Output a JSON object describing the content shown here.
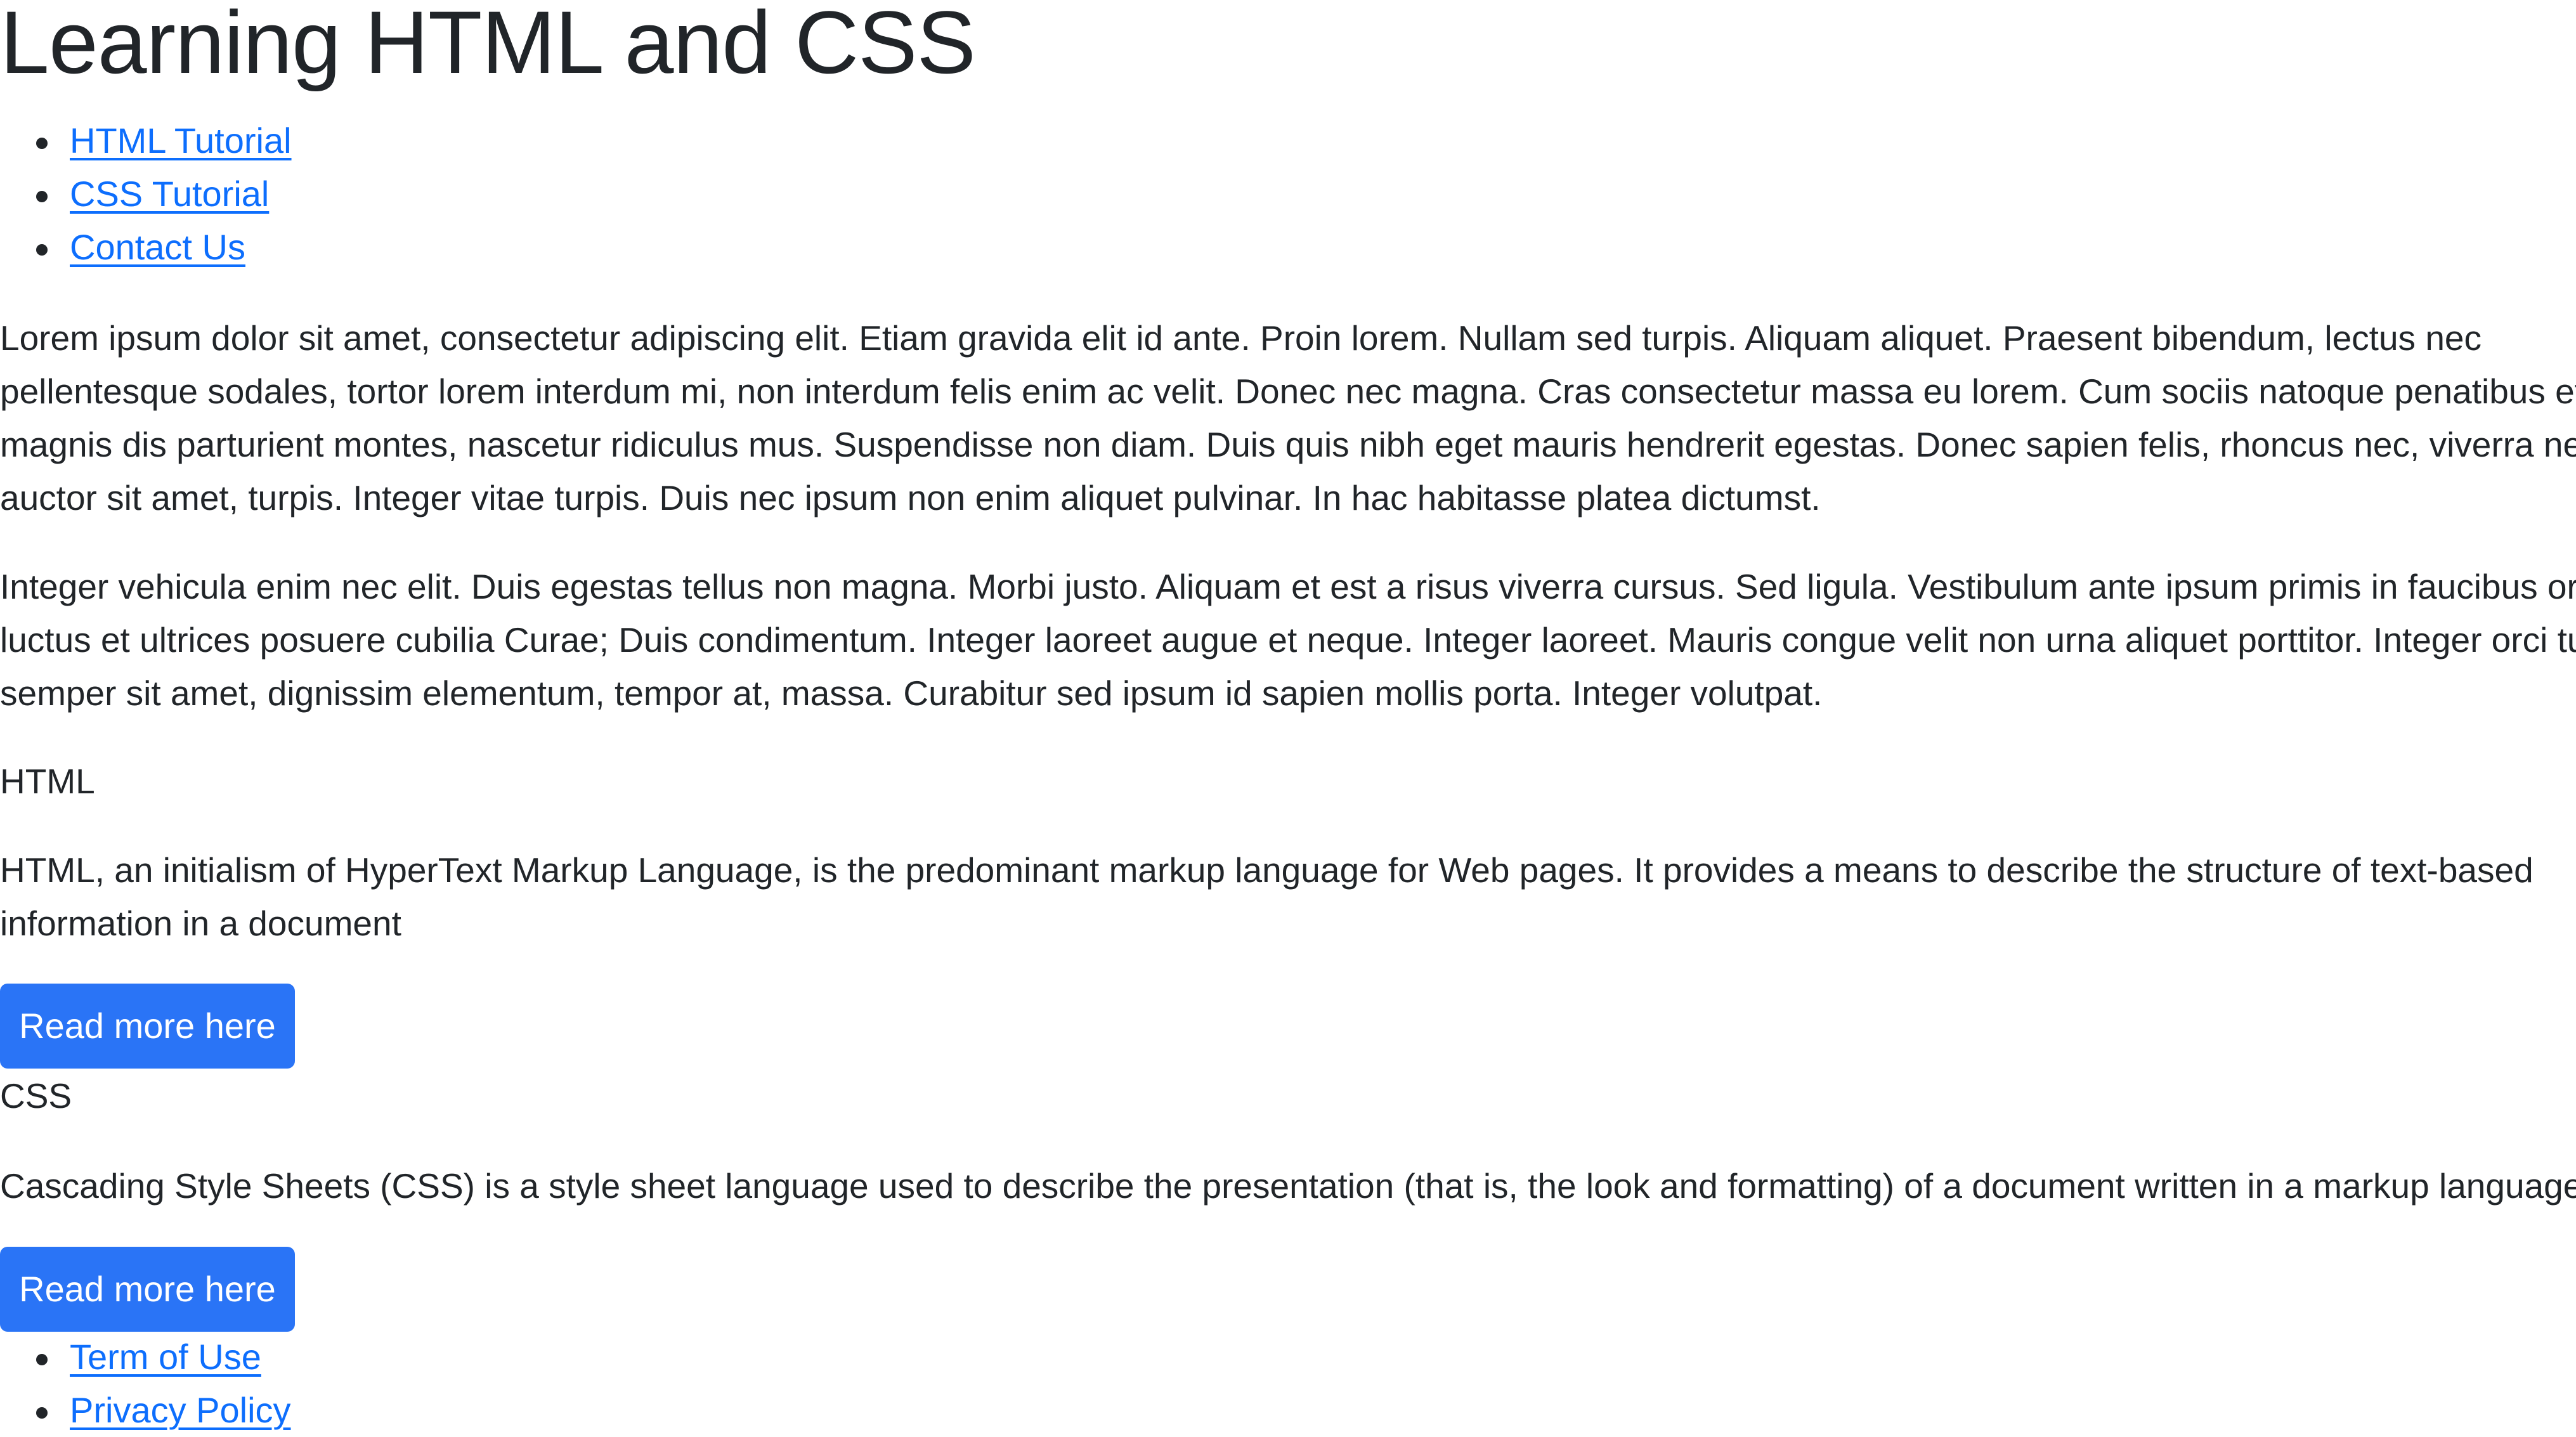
{
  "page": {
    "title": "Learning HTML and CSS"
  },
  "nav": {
    "items": [
      {
        "label": "HTML Tutorial"
      },
      {
        "label": "CSS Tutorial"
      },
      {
        "label": "Contact Us"
      }
    ]
  },
  "intro": {
    "paragraph_1_lines": [
      "Lorem ipsum dolor sit amet, consectetur adipiscing elit. Etiam gravida elit id ante. Proin lorem. Nullam sed turpis. Aliquam aliquet. Praesent bibendum, lectus nec",
      "pellentesque sodales, tortor lorem interdum mi, non interdum felis enim ac velit. Donec nec magna. Cras consectetur massa eu lorem. Cum sociis natoque penatibus et",
      "magnis dis parturient montes, nascetur ridiculus mus. Suspendisse non diam. Duis quis nibh eget mauris hendrerit egestas. Donec sapien felis, rhoncus nec, viverra nec,",
      "auctor sit amet, turpis. Integer vitae turpis. Duis nec ipsum non enim aliquet pulvinar. In hac habitasse platea dictumst."
    ],
    "paragraph_2_lines": [
      "Integer vehicula enim nec elit. Duis egestas tellus non magna. Morbi justo. Aliquam et est a risus viverra cursus. Sed ligula. Vestibulum ante ipsum primis in faucibus orci",
      "luctus et ultrices posuere cubilia Curae; Duis condimentum. Integer laoreet augue et neque. Integer laoreet. Mauris congue velit non urna aliquet porttitor. Integer orci turpis,",
      "semper sit amet, dignissim elementum, tempor at, massa. Curabitur sed ipsum id sapien mollis porta. Integer volutpat."
    ]
  },
  "sections": [
    {
      "heading": "HTML",
      "description_lines": [
        "HTML, an initialism of HyperText Markup Language, is the predominant markup language for Web pages. It provides a means to describe the structure of text-based",
        "information in a document"
      ],
      "button_label": "Read more here"
    },
    {
      "heading": "CSS",
      "description_lines": [
        "Cascading Style Sheets (CSS) is a style sheet language used to describe the presentation (that is, the look and formatting) of a document written in a markup language"
      ],
      "button_label": "Read more here"
    }
  ],
  "footer": {
    "links": [
      {
        "label": "Term of Use"
      },
      {
        "label": "Privacy Policy"
      }
    ]
  },
  "colors": {
    "text": "#212529",
    "link": "#0d6efd",
    "button_bg": "#2a74f6",
    "button_text": "#ffffff",
    "background": "#ffffff"
  }
}
